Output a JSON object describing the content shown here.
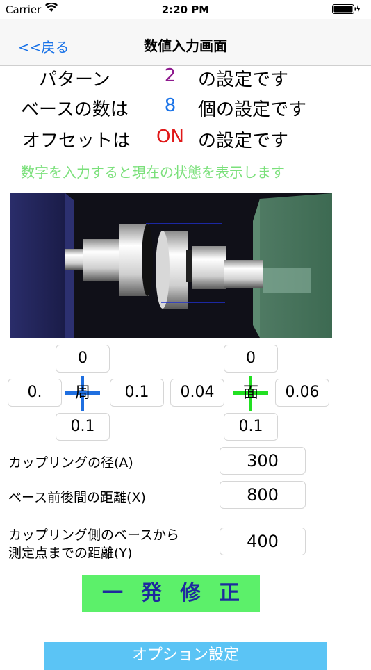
{
  "status_bar": {
    "carrier": "Carrier",
    "time": "2:20 PM"
  },
  "nav": {
    "back": "<<戻る",
    "title": "数値入力画面"
  },
  "info": {
    "pattern_label": "パターン",
    "pattern_value": "2",
    "pattern_suffix": "の設定です",
    "base_label": "ベースの数は",
    "base_value": "8",
    "base_suffix": "個の設定です",
    "offset_label": "オフセットは",
    "offset_value": "ON",
    "offset_suffix": "の設定です",
    "hint": "数字を入力すると現在の状態を表示します"
  },
  "colors": {
    "pattern": "#8e1a8e",
    "base": "#1a73e8",
    "offset": "#e01818",
    "hint": "#7be07b",
    "blue_cross": "#1f6fe0",
    "green_cross": "#22e022"
  },
  "peripheral": {
    "label": "周",
    "top": "0",
    "left": "0.",
    "right": "0.1",
    "bottom": "0.1"
  },
  "face": {
    "label": "面",
    "top": "0",
    "left": "0.04",
    "right": "0.06",
    "bottom": "0.1"
  },
  "fields": {
    "coupling_diameter_label": "カップリングの径(A)",
    "coupling_diameter_value": "300",
    "base_distance_label": "ベース前後間の距離(X)",
    "base_distance_value": "800",
    "measure_distance_label_1": "カップリング側のベースから",
    "measure_distance_label_2": "測定点までの距離(Y)",
    "measure_distance_value": "400"
  },
  "buttons": {
    "fix": "一発修正",
    "option": "オプション設定"
  }
}
